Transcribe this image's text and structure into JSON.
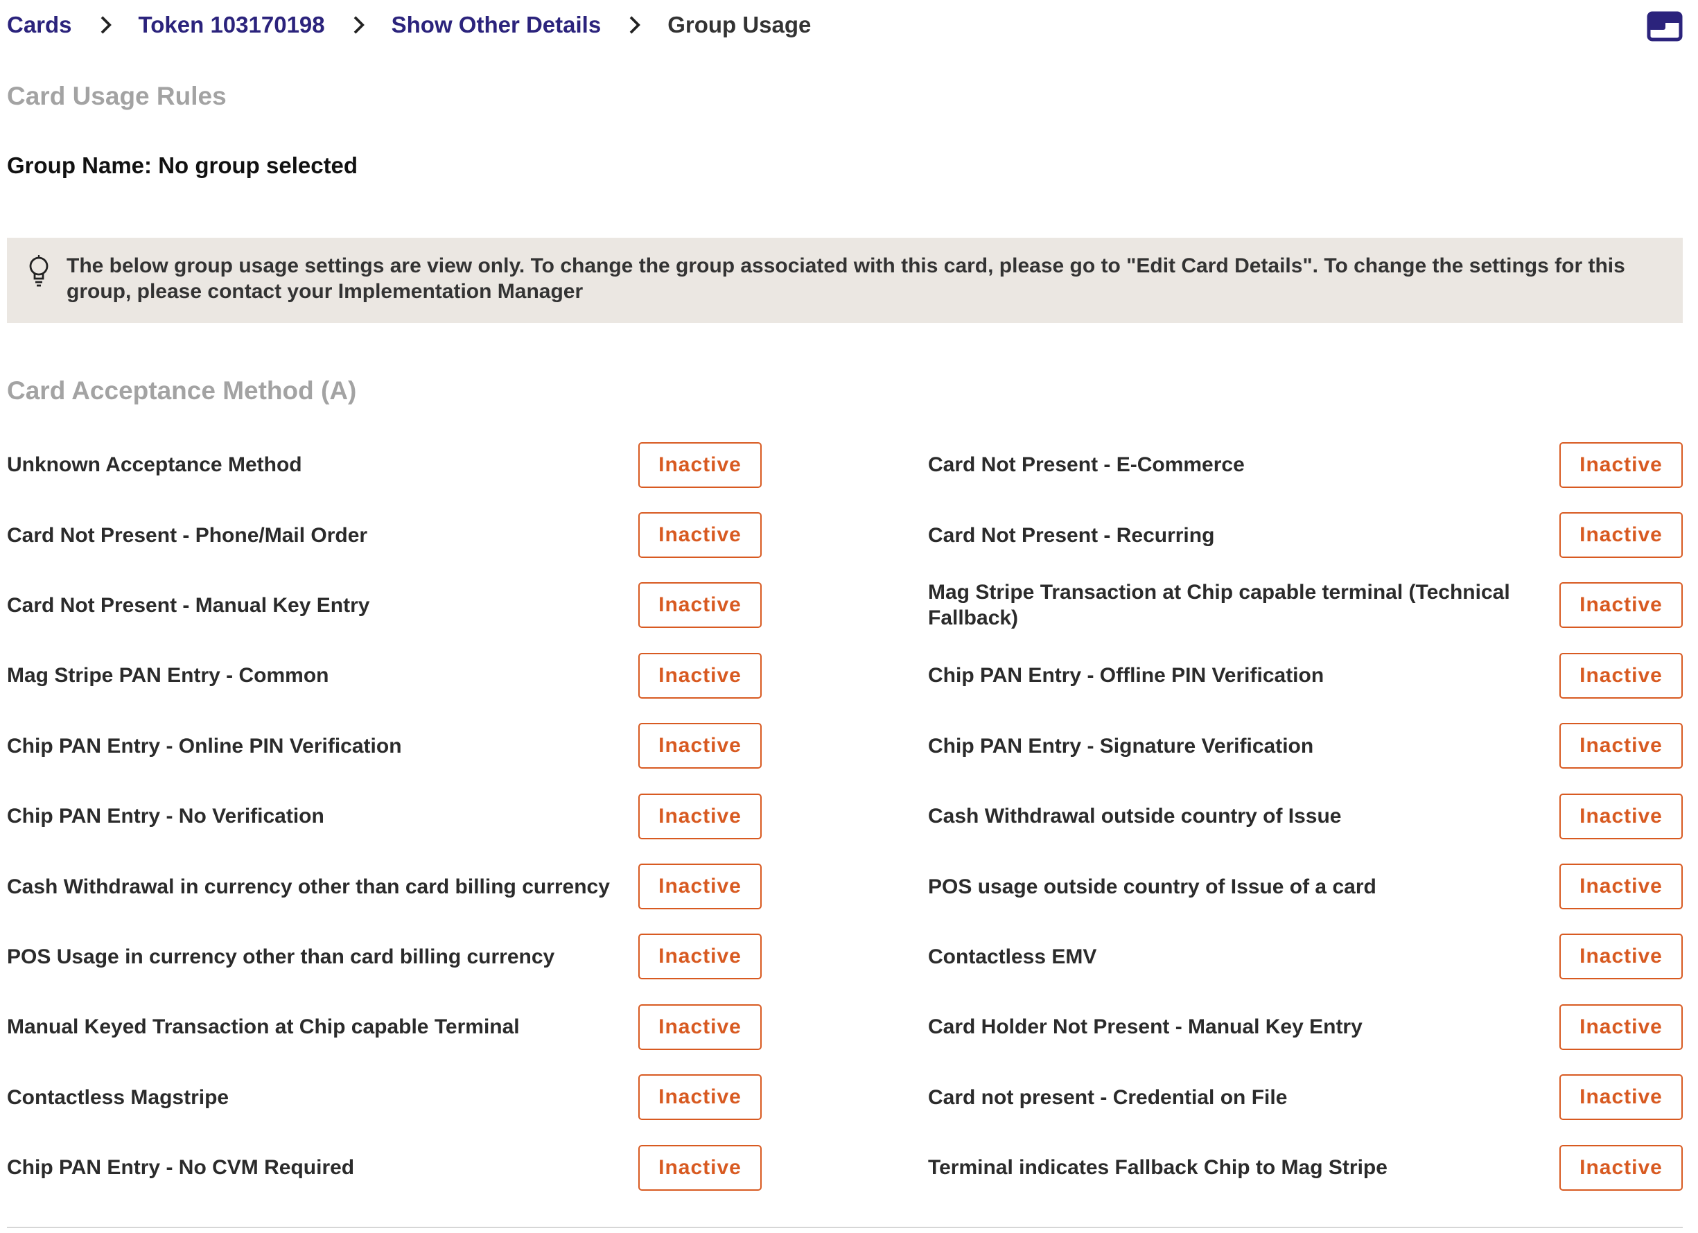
{
  "breadcrumb": {
    "items": [
      "Cards",
      "Token 103170198",
      "Show Other Details"
    ],
    "current": "Group Usage"
  },
  "page": {
    "title": "Card Usage Rules",
    "group_name": "Group Name: No group selected"
  },
  "info_banner": {
    "icon": "lightbulb-icon",
    "text": "The below group usage settings are view only. To change the group associated with this card, please go to \"Edit Card Details\". To change the settings for this group, please contact your Implementation Manager"
  },
  "section": {
    "title": "Card Acceptance Method (A)"
  },
  "rules": [
    {
      "label": "Unknown Acceptance Method",
      "status": "Inactive"
    },
    {
      "label": "Card Not Present - E-Commerce",
      "status": "Inactive"
    },
    {
      "label": "Card Not Present - Phone/Mail Order",
      "status": "Inactive"
    },
    {
      "label": "Card Not Present - Recurring",
      "status": "Inactive"
    },
    {
      "label": "Card Not Present - Manual Key Entry",
      "status": "Inactive"
    },
    {
      "label": "Mag Stripe Transaction at Chip capable terminal (Technical Fallback)",
      "status": "Inactive"
    },
    {
      "label": "Mag Stripe PAN Entry - Common",
      "status": "Inactive"
    },
    {
      "label": "Chip PAN Entry - Offline PIN Verification",
      "status": "Inactive"
    },
    {
      "label": "Chip PAN Entry - Online PIN Verification",
      "status": "Inactive"
    },
    {
      "label": "Chip PAN Entry - Signature Verification",
      "status": "Inactive"
    },
    {
      "label": "Chip PAN Entry - No Verification",
      "status": "Inactive"
    },
    {
      "label": "Cash Withdrawal outside country of Issue",
      "status": "Inactive"
    },
    {
      "label": "Cash Withdrawal in currency other than card billing currency",
      "status": "Inactive"
    },
    {
      "label": "POS usage outside country of Issue of a card",
      "status": "Inactive"
    },
    {
      "label": "POS Usage in currency other than card billing currency",
      "status": "Inactive"
    },
    {
      "label": "Contactless EMV",
      "status": "Inactive"
    },
    {
      "label": "Manual Keyed Transaction at Chip capable Terminal",
      "status": "Inactive"
    },
    {
      "label": "Card Holder Not Present - Manual Key Entry",
      "status": "Inactive"
    },
    {
      "label": "Contactless Magstripe",
      "status": "Inactive"
    },
    {
      "label": "Card not present - Credential on File",
      "status": "Inactive"
    },
    {
      "label": "Chip PAN Entry - No CVM Required",
      "status": "Inactive"
    },
    {
      "label": "Terminal indicates Fallback Chip to Mag Stripe",
      "status": "Inactive"
    }
  ],
  "colors": {
    "link": "#2b237c",
    "accent": "#d85a21",
    "banner_bg": "#ebe7e2",
    "muted_title": "#a3a3a3"
  }
}
